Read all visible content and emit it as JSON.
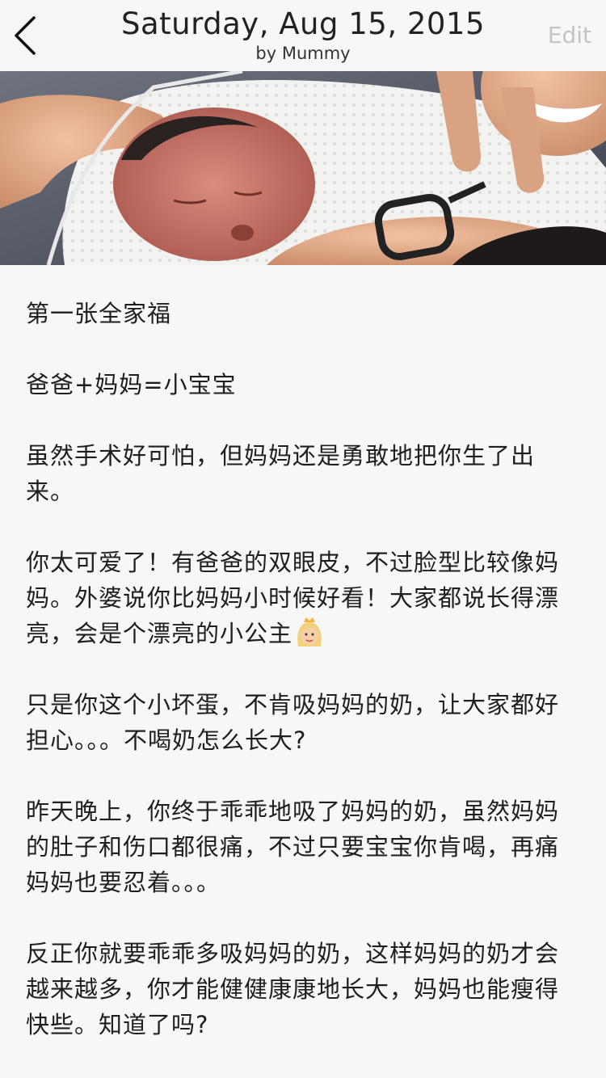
{
  "header": {
    "title": "Saturday, Aug 15, 2015",
    "subtitle": "by Mummy",
    "edit_label": "Edit",
    "back_icon": "chevron-left-icon"
  },
  "photo": {
    "subject": "newborn baby wrapped in white blanket with family"
  },
  "entry": {
    "paragraphs": [
      "第一张全家福",
      "爸爸+妈妈=小宝宝",
      "虽然手术好可怕，但妈妈还是勇敢地把你生了出来。",
      "你太可爱了！有爸爸的双眼皮，不过脸型比较像妈妈。外婆说你比妈妈小时候好看！大家都说长得漂亮，会是个漂亮的小公主",
      "只是你这个小坏蛋，不肯吸妈妈的奶，让大家都好担心。。。不喝奶怎么长大?",
      "昨天晚上，你终于乖乖地吸了妈妈的奶，虽然妈妈的肚子和伤口都很痛，不过只要宝宝你肯喝，再痛妈妈也要忍着。。。",
      "反正你就要乖乖多吸妈妈的奶，这样妈妈的奶才会越来越多，你才能健健康康地长大，妈妈也能瘦得快些。知道了吗?"
    ],
    "princess_emoji_icon": "princess-emoji-icon"
  },
  "colors": {
    "background": "#f7f7f7",
    "text": "#1e1e1e",
    "edit_disabled": "#c4c4c4"
  }
}
